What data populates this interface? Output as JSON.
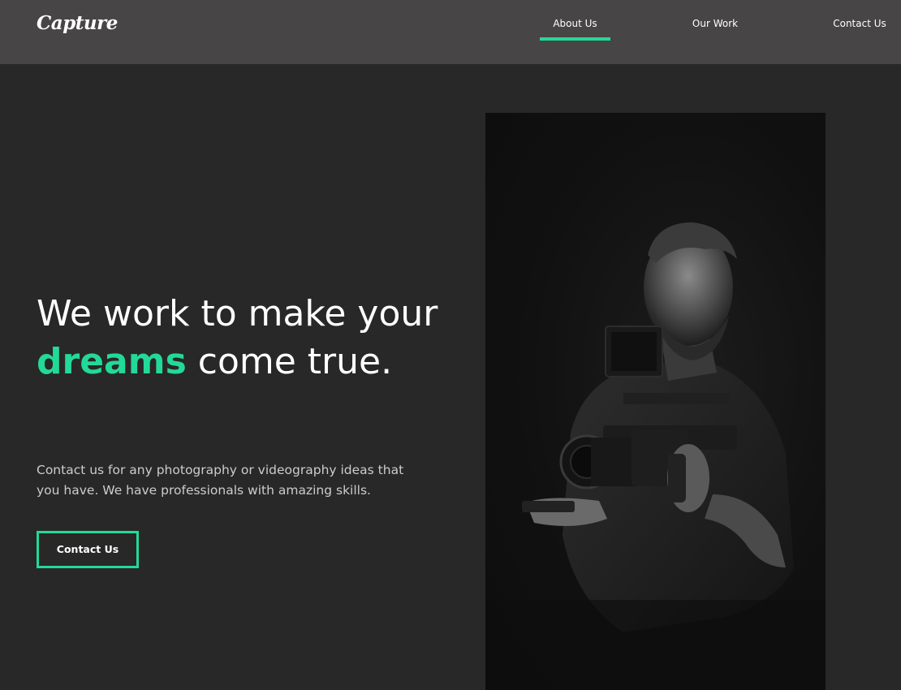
{
  "header": {
    "logo": "Capture",
    "nav": [
      {
        "label": "About Us",
        "active": true
      },
      {
        "label": "Our Work",
        "active": false
      },
      {
        "label": "Contact Us",
        "active": false
      }
    ]
  },
  "hero": {
    "title_part1": "We work to make your ",
    "title_accent": "dreams",
    "title_part2": " come true.",
    "description": "Contact us for any photography or videography ideas that you have. We have professionals with amazing skills.",
    "cta_label": "Contact Us"
  },
  "colors": {
    "accent": "#23d997",
    "header_bg": "#474546",
    "page_bg": "#282828"
  },
  "icons": {
    "hero_image": "photographer-with-camera-image"
  }
}
